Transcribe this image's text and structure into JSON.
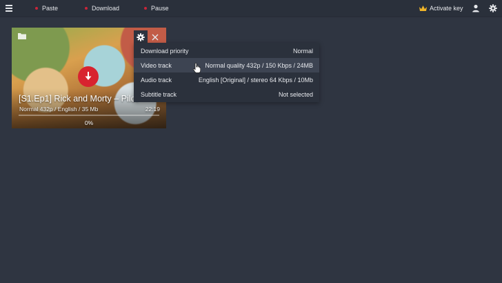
{
  "toolbar": {
    "paste_label": "Paste",
    "download_label": "Download",
    "pause_label": "Pause",
    "activate_label": "Activate key",
    "accent": "#c9253a",
    "crown_color": "#f0b429"
  },
  "card": {
    "title": "[S1.Ep1] Rick and Morty – Pilot",
    "meta": "Normal 432p / English / 35 Mb",
    "duration": "22:19",
    "progress_text": "0%",
    "progress": 0
  },
  "settings": {
    "rows": [
      {
        "label": "Download priority",
        "value": "Normal"
      },
      {
        "label": "Video track",
        "value": "Normal quality 432p / 150 Kbps / 24MB"
      },
      {
        "label": "Audio track",
        "value": "English [Original] / stereo 64 Kbps / 10Mb"
      },
      {
        "label": "Subtitle track",
        "value": "Not selected"
      }
    ],
    "highlighted_row": 1
  },
  "icons": [
    "menu-icon",
    "folder-icon",
    "download-arrow-icon",
    "gear-icon",
    "close-icon",
    "crown-icon",
    "user-icon",
    "settings-icon",
    "pointer-cursor-icon"
  ]
}
